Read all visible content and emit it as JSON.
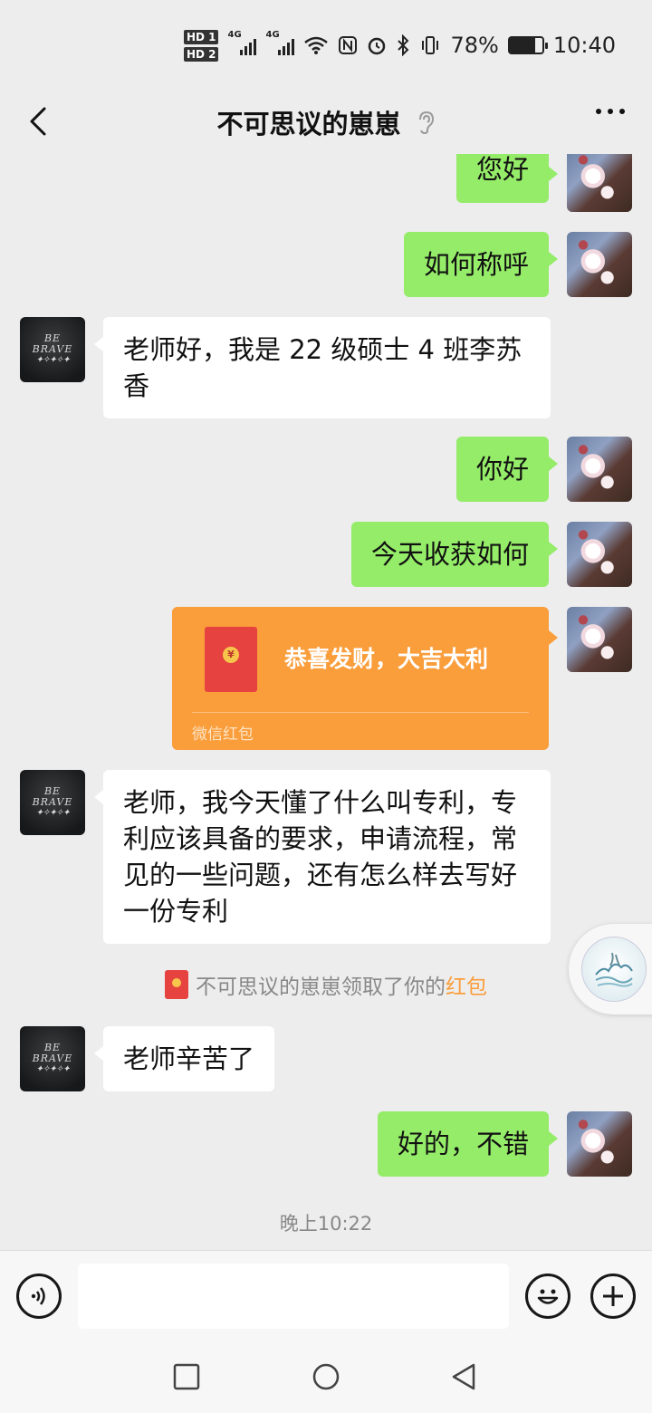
{
  "status_bar": {
    "hd1": "HD 1",
    "hd2": "HD 2",
    "net1": "4G",
    "net2": "4G",
    "battery": "78%",
    "battery_level": 0.78,
    "time": "10:40"
  },
  "header": {
    "title": "不可思议的崽崽"
  },
  "messages": [
    {
      "side": "me",
      "text": "您好"
    },
    {
      "side": "me",
      "text": "如何称呼"
    },
    {
      "side": "her",
      "text": "老师好，我是 22 级硕士 4 班李苏香"
    },
    {
      "side": "me",
      "text": "你好"
    },
    {
      "side": "me",
      "text": "今天收获如何"
    },
    {
      "side": "her",
      "text": "老师，我今天懂了什么叫专利，专利应该具备的要求，申请流程，常见的一些问题，还有怎么样去写好一份专利"
    },
    {
      "side": "her",
      "text": "老师辛苦了"
    },
    {
      "side": "me",
      "text": "好的，不错"
    }
  ],
  "red_packet": {
    "title": "恭喜发财，大吉大利",
    "footer": "微信红包",
    "coin": "¥"
  },
  "system_note": {
    "prefix": "不可思议的崽崽领取了你的",
    "link": "红包"
  },
  "time_note": "晚上10:22",
  "avatar_text": {
    "line1": "BE",
    "line2": "BRAVE",
    "leaves": "✦✧✦✧✦"
  },
  "input": {
    "value": "",
    "placeholder": ""
  },
  "colors": {
    "my_bubble": "#95ec69",
    "their_bubble": "#ffffff",
    "red_packet": "#fa9d3b",
    "background": "#ededed"
  },
  "icons": [
    "back-arrow-icon",
    "ear-icon",
    "more-icon",
    "voice-icon",
    "emoji-icon",
    "plus-icon",
    "nav-square-icon",
    "nav-circle-icon",
    "nav-triangle-icon"
  ]
}
